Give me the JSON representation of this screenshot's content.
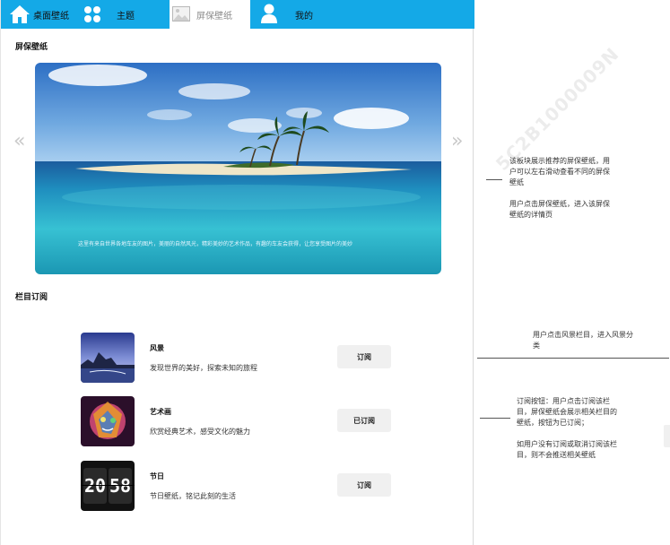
{
  "nav": {
    "items": [
      {
        "label": "桌面壁纸",
        "icon": "home-icon"
      },
      {
        "label": "主题",
        "icon": "grid-icon"
      },
      {
        "label": "屏保壁纸",
        "icon": "image-icon"
      },
      {
        "label": "我的",
        "icon": "user-icon"
      }
    ],
    "active": "屏保壁纸",
    "accent": "#14a9e7"
  },
  "screensaver": {
    "title": "屏保壁纸",
    "caption": "这里有来自世界各地车友的图片，美丽的自然风光，精彩美妙的艺术作品，有趣的车友会获得，让您享受图片的美妙",
    "prev_icon": "chevron-left-icon",
    "next_icon": "chevron-right-icon"
  },
  "subscriptions": {
    "title": "栏目订阅",
    "items": [
      {
        "name": "风景",
        "desc": "发现世界的美好，探索未知的旅程",
        "button": "订阅"
      },
      {
        "name": "艺术画",
        "desc": "欣赏经典艺术，感受文化的魅力",
        "button": "已订阅"
      },
      {
        "name": "节日",
        "desc": "节日壁纸，铭记此刻的生活",
        "button": "订阅",
        "clock": [
          "20",
          "58"
        ]
      }
    ]
  },
  "notes": {
    "banner": [
      "该板块展示推荐的屏保壁纸，用户可以左右滑动查看不同的屏保壁纸",
      "用户点击屏保壁纸，进入该屏保壁纸的详情页"
    ],
    "category": "用户点击风景栏目，进入风景分类",
    "subscribe": [
      "订阅按钮：用户点击订阅该栏目，屏保壁纸会展示相关栏目的壁纸，按钮为已订阅；",
      "如用户没有订阅或取消订阅该栏目，则不会推送相关壁纸"
    ]
  },
  "watermark": "5C2B1000009N"
}
